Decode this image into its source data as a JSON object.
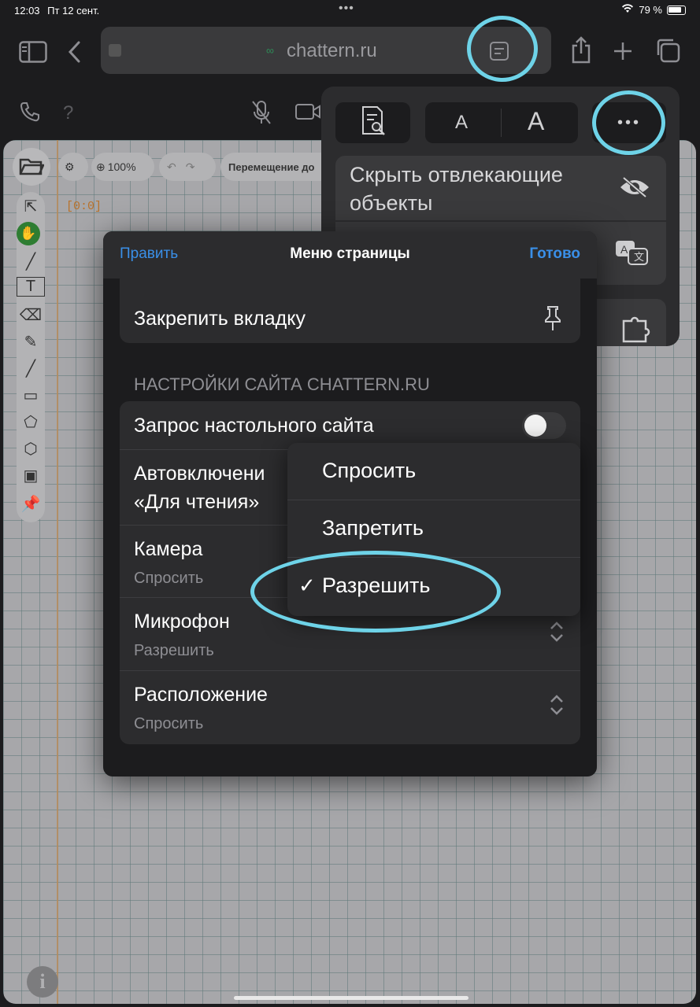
{
  "status_bar": {
    "time": "12:03",
    "date": "Пт 12 сент.",
    "battery": "79 %"
  },
  "browser": {
    "url": "chattern.ru"
  },
  "site_toolbar": {
    "help": "?"
  },
  "canvas": {
    "coord": "[0:0]",
    "zoom": "100%",
    "mode_label": "Перемещение до"
  },
  "popover": {
    "font_small": "A",
    "font_large": "A",
    "more": "•••",
    "hide_distracting": "Скрыть отвлекающие объекты"
  },
  "sheet": {
    "edit": "Править",
    "title": "Меню страницы",
    "done": "Готово",
    "pin_tab": "Закрепить вкладку",
    "section_title": "НАСТРОЙКИ САЙТА CHATTERN.RU",
    "rows": {
      "desktop_site": "Запрос настольного сайта",
      "reader_line1": "Автовключени",
      "reader_line2": "«Для чтения»",
      "camera": "Камера",
      "camera_value": "Спросить",
      "microphone": "Микрофон",
      "microphone_value": "Разрешить",
      "location": "Расположение",
      "location_value": "Спросить"
    }
  },
  "dropdown": {
    "options": [
      "Спросить",
      "Запретить",
      "Разрешить"
    ],
    "selected": "Разрешить"
  },
  "colors": {
    "accent": "#3a8fe8",
    "annotation": "#6ed3e8"
  }
}
